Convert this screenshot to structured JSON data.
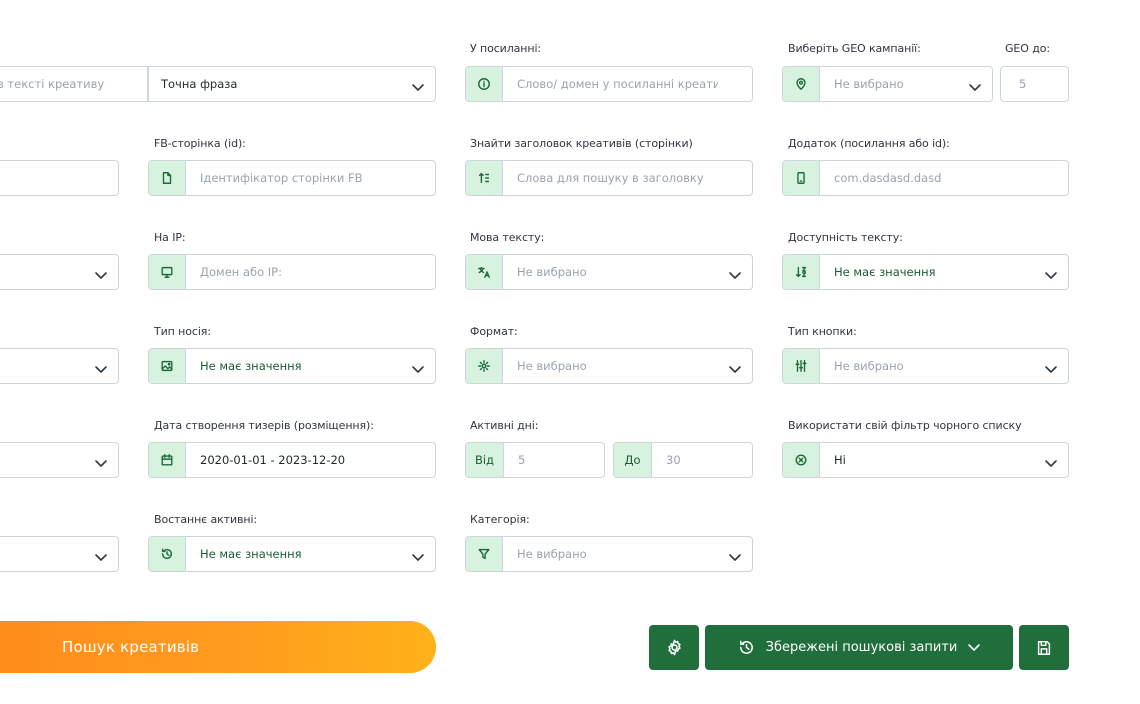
{
  "rows": {
    "row1": {
      "text_search_placeholder": "в тексті креативу",
      "match_type": "Точна фраза",
      "link_label": "У посиланні:",
      "link_placeholder": "Слово/ домен у посиланні креативу",
      "geo_label": "Виберіть GEO кампанії:",
      "geo_value": "Не вибрано",
      "geo_to_label": "GEO до:",
      "geo_to_value": "5"
    },
    "row2": {
      "fb_label": "FB-сторінка (id):",
      "fb_placeholder": "Ідентифікатор сторінки FB",
      "headline_label": "Знайти заголовок креативів (сторінки)",
      "headline_placeholder": "Слова для пошуку в заголовку",
      "app_label": "Додаток (посилання або id):",
      "app_placeholder": "com.dasdasd.dasd"
    },
    "row3": {
      "ip_label": "На IP:",
      "ip_placeholder": "Домен або IP:",
      "lang_label": "Мова тексту:",
      "lang_value": "Не вибрано",
      "avail_label": "Доступність тексту:",
      "avail_value": "Не має значення"
    },
    "row4": {
      "media_label": "Тип носія:",
      "media_value": "Не має значення",
      "format_label": "Формат:",
      "format_value": "Не вибрано",
      "button_type_label": "Тип кнопки:",
      "button_type_value": "Не вибрано"
    },
    "row5": {
      "date_label": "Дата створення тизерів (розміщення):",
      "date_value": "2020-01-01 - 2023-12-20",
      "active_days_label": "Активні дні:",
      "from_label": "Від",
      "from_value": "5",
      "to_label": "До",
      "to_value": "30",
      "blacklist_label": "Використати свій фільтр чорного списку",
      "blacklist_value": "Ні"
    },
    "row6": {
      "last_active_label": "Востаннє активні:",
      "last_active_value": "Не має значення",
      "category_label": "Категорія:",
      "category_value": "Не вибрано"
    }
  },
  "actions": {
    "search_label": "Пошук креативів",
    "saved_queries_label": "Збережені пошукові запити"
  },
  "colors": {
    "accent_green": "#1f6e3c",
    "icon_bg": "#d7f3e0",
    "search_orange": "#ff9d1e"
  },
  "icons": [
    "info-icon",
    "map-pin-icon",
    "page-icon",
    "sort-icon",
    "phone-icon",
    "monitor-icon",
    "translate-icon",
    "sort-az-icon",
    "image-icon",
    "gear-icon",
    "sliders-icon",
    "calendar-icon",
    "x-circle-icon",
    "history-icon",
    "filter-icon",
    "save-icon",
    "chevron-down-icon"
  ]
}
